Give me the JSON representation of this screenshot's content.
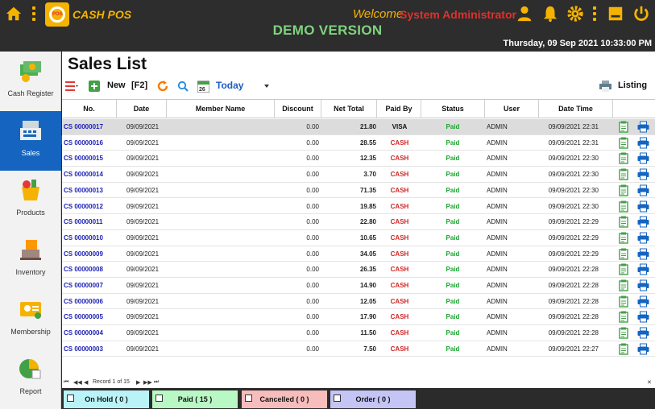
{
  "app": {
    "logo_text": "CASH POS",
    "logo_badge": "POS",
    "welcome": "Welcome",
    "user": "System Administrator",
    "banner": "DEMO VERSION",
    "datetime": "Thursday, 09 Sep 2021 10:33:00 PM"
  },
  "colors": {
    "accent": "#f5b301",
    "active_nav": "#1565c0",
    "cash": "#d12727",
    "paid": "#1aa32f",
    "number": "#1a1fb5"
  },
  "sidebar": {
    "items": [
      {
        "label": "Cash Register",
        "icon": "cash-register-icon"
      },
      {
        "label": "Sales",
        "icon": "sales-icon",
        "active": true
      },
      {
        "label": "Products",
        "icon": "products-icon"
      },
      {
        "label": "Inventory",
        "icon": "inventory-icon"
      },
      {
        "label": "Membership",
        "icon": "membership-icon"
      },
      {
        "label": "Report",
        "icon": "report-icon"
      }
    ]
  },
  "page": {
    "title": "Sales List",
    "new_label": "New",
    "new_shortcut": "[F2]",
    "filter": "Today",
    "listing_label": "Listing"
  },
  "table": {
    "columns": [
      "No.",
      "Date",
      "Member Name",
      "Discount",
      "Net Total",
      "Paid By",
      "Status",
      "User",
      "Date Time"
    ],
    "rows": [
      {
        "no": "CS 00000017",
        "date": "09/09/2021",
        "member": "",
        "discount": "0.00",
        "net": "21.80",
        "paid_by": "VISA",
        "status": "Paid",
        "user": "ADMIN",
        "datetime": "09/09/2021 22:31",
        "selected": true
      },
      {
        "no": "CS 00000016",
        "date": "09/09/2021",
        "member": "",
        "discount": "0.00",
        "net": "28.55",
        "paid_by": "CASH",
        "status": "Paid",
        "user": "ADMIN",
        "datetime": "09/09/2021 22:31"
      },
      {
        "no": "CS 00000015",
        "date": "09/09/2021",
        "member": "",
        "discount": "0.00",
        "net": "12.35",
        "paid_by": "CASH",
        "status": "Paid",
        "user": "ADMIN",
        "datetime": "09/09/2021 22:30"
      },
      {
        "no": "CS 00000014",
        "date": "09/09/2021",
        "member": "",
        "discount": "0.00",
        "net": "3.70",
        "paid_by": "CASH",
        "status": "Paid",
        "user": "ADMIN",
        "datetime": "09/09/2021 22:30"
      },
      {
        "no": "CS 00000013",
        "date": "09/09/2021",
        "member": "",
        "discount": "0.00",
        "net": "71.35",
        "paid_by": "CASH",
        "status": "Paid",
        "user": "ADMIN",
        "datetime": "09/09/2021 22:30"
      },
      {
        "no": "CS 00000012",
        "date": "09/09/2021",
        "member": "",
        "discount": "0.00",
        "net": "19.85",
        "paid_by": "CASH",
        "status": "Paid",
        "user": "ADMIN",
        "datetime": "09/09/2021 22:30"
      },
      {
        "no": "CS 00000011",
        "date": "09/09/2021",
        "member": "",
        "discount": "0.00",
        "net": "22.80",
        "paid_by": "CASH",
        "status": "Paid",
        "user": "ADMIN",
        "datetime": "09/09/2021 22:29"
      },
      {
        "no": "CS 00000010",
        "date": "09/09/2021",
        "member": "",
        "discount": "0.00",
        "net": "10.65",
        "paid_by": "CASH",
        "status": "Paid",
        "user": "ADMIN",
        "datetime": "09/09/2021 22:29"
      },
      {
        "no": "CS 00000009",
        "date": "09/09/2021",
        "member": "",
        "discount": "0.00",
        "net": "34.05",
        "paid_by": "CASH",
        "status": "Paid",
        "user": "ADMIN",
        "datetime": "09/09/2021 22:29"
      },
      {
        "no": "CS 00000008",
        "date": "09/09/2021",
        "member": "",
        "discount": "0.00",
        "net": "26.35",
        "paid_by": "CASH",
        "status": "Paid",
        "user": "ADMIN",
        "datetime": "09/09/2021 22:28"
      },
      {
        "no": "CS 00000007",
        "date": "09/09/2021",
        "member": "",
        "discount": "0.00",
        "net": "14.90",
        "paid_by": "CASH",
        "status": "Paid",
        "user": "ADMIN",
        "datetime": "09/09/2021 22:28"
      },
      {
        "no": "CS 00000006",
        "date": "09/09/2021",
        "member": "",
        "discount": "0.00",
        "net": "12.05",
        "paid_by": "CASH",
        "status": "Paid",
        "user": "ADMIN",
        "datetime": "09/09/2021 22:28"
      },
      {
        "no": "CS 00000005",
        "date": "09/09/2021",
        "member": "",
        "discount": "0.00",
        "net": "17.90",
        "paid_by": "CASH",
        "status": "Paid",
        "user": "ADMIN",
        "datetime": "09/09/2021 22:28"
      },
      {
        "no": "CS 00000004",
        "date": "09/09/2021",
        "member": "",
        "discount": "0.00",
        "net": "11.50",
        "paid_by": "CASH",
        "status": "Paid",
        "user": "ADMIN",
        "datetime": "09/09/2021 22:28"
      },
      {
        "no": "CS 00000003",
        "date": "09/09/2021",
        "member": "",
        "discount": "0.00",
        "net": "7.50",
        "paid_by": "CASH",
        "status": "Paid",
        "user": "ADMIN",
        "datetime": "09/09/2021 22:27"
      }
    ]
  },
  "pager": {
    "record_text": "Record 1 of 15"
  },
  "bottom_tabs": [
    {
      "label": "On Hold  ( 0 )",
      "color": "#b9f3f7"
    },
    {
      "label": "Paid  ( 15 )",
      "color": "#b9f7c4"
    },
    {
      "label": "Cancelled  ( 0 )",
      "color": "#f7bcbc"
    },
    {
      "label": "Order  ( 0 )",
      "color": "#c4c4f5"
    }
  ]
}
